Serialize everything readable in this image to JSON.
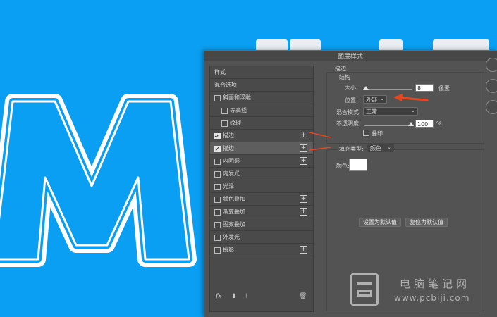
{
  "dialog": {
    "title": "图层样式"
  },
  "canvas": {
    "letter": "M"
  },
  "styles_list": {
    "header": "样式",
    "blend_options": "混合选项",
    "items": [
      {
        "label": "斜面和浮雕",
        "checked": false,
        "sub": false,
        "plus": false,
        "selected": false
      },
      {
        "label": "等高线",
        "checked": false,
        "sub": true,
        "plus": false,
        "selected": false
      },
      {
        "label": "纹理",
        "checked": false,
        "sub": true,
        "plus": false,
        "selected": false
      },
      {
        "label": "描边",
        "checked": true,
        "sub": false,
        "plus": true,
        "selected": false
      },
      {
        "label": "描边",
        "checked": true,
        "sub": false,
        "plus": true,
        "selected": true
      },
      {
        "label": "内阴影",
        "checked": false,
        "sub": false,
        "plus": true,
        "selected": false
      },
      {
        "label": "内发光",
        "checked": false,
        "sub": false,
        "plus": false,
        "selected": false
      },
      {
        "label": "光泽",
        "checked": false,
        "sub": false,
        "plus": false,
        "selected": false
      },
      {
        "label": "颜色叠加",
        "checked": false,
        "sub": false,
        "plus": true,
        "selected": false
      },
      {
        "label": "渐变叠加",
        "checked": false,
        "sub": false,
        "plus": true,
        "selected": false
      },
      {
        "label": "图案叠加",
        "checked": false,
        "sub": false,
        "plus": false,
        "selected": false
      },
      {
        "label": "外发光",
        "checked": false,
        "sub": false,
        "plus": false,
        "selected": false
      },
      {
        "label": "投影",
        "checked": false,
        "sub": false,
        "plus": true,
        "selected": false
      }
    ],
    "footer": {
      "fx": "fx",
      "up": "⬆",
      "down": "⬇",
      "trash": "🗑"
    }
  },
  "stroke": {
    "section_title": "描边",
    "structure_title": "结构",
    "size": {
      "label": "大小:",
      "value": "8",
      "unit": "像素"
    },
    "position": {
      "label": "位置:",
      "value": "外部"
    },
    "blend_mode": {
      "label": "混合模式:",
      "value": "正常"
    },
    "opacity": {
      "label": "不透明度:",
      "value": "100",
      "unit": "%"
    },
    "overprint": {
      "label": "叠印",
      "checked": false
    },
    "fill_type": {
      "label": "填充类型:",
      "value": "颜色"
    },
    "color": {
      "label": "颜色:",
      "value": "#ffffff"
    },
    "set_default": "设置为默认值",
    "reset_default": "复位为默认值"
  },
  "watermark": {
    "text_cn": "电脑笔记网",
    "url": "www.pcbiji.com"
  },
  "colors": {
    "background": "#0a9ff2",
    "arrow": "#e8461e",
    "dialog": "#535353"
  }
}
